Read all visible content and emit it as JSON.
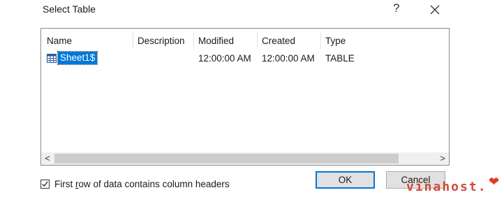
{
  "dialog": {
    "title": "Select Table",
    "help_label": "?",
    "close_icon": "close-icon"
  },
  "table": {
    "columns": [
      "Name",
      "Description",
      "Modified",
      "Created",
      "Type"
    ],
    "rows": [
      {
        "name": "Sheet1$",
        "description": "",
        "modified": "12:00:00 AM",
        "created": "12:00:00 AM",
        "type": "TABLE",
        "selected": true
      }
    ]
  },
  "scrollbar": {
    "left_arrow": "<",
    "right_arrow": ">"
  },
  "options": {
    "header_checkbox_label_pre": "First ",
    "header_checkbox_label_access": "r",
    "header_checkbox_label_post": "ow of data contains column headers",
    "header_checkbox_checked": true
  },
  "buttons": {
    "ok": "OK",
    "cancel": "Cancel"
  },
  "watermark": {
    "text": "vinahost.",
    "icon": "heart-icon"
  },
  "colors": {
    "selection": "#0078d7",
    "ok_border": "#0078d7",
    "watermark": "#d04a3a"
  }
}
